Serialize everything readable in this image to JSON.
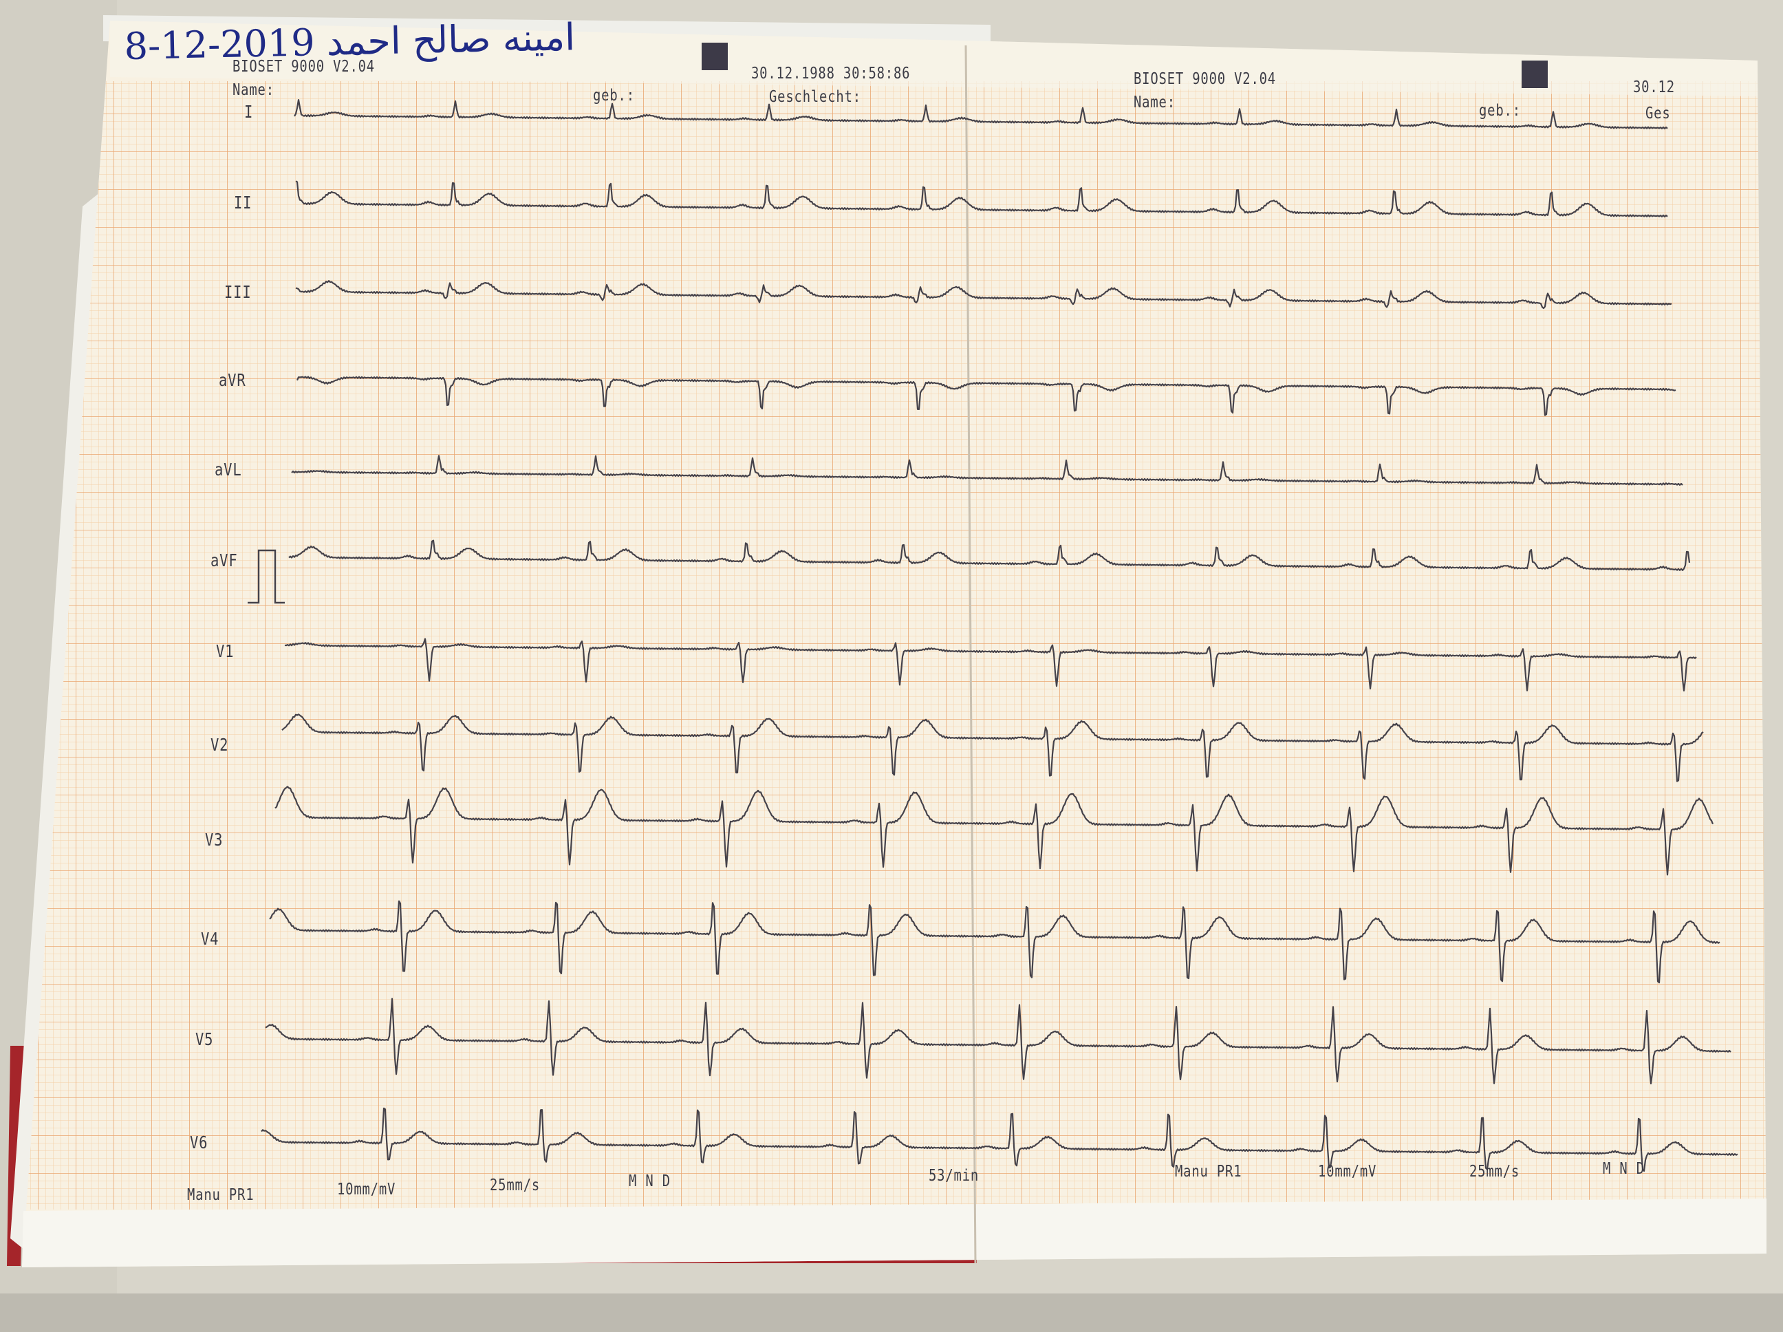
{
  "handwritten_note": "8-12-2019 امينه صالح احمد",
  "sheet_left": {
    "device": "BIOSET 9000 V2.04",
    "timestamp": "30.12.1988 30:58:86",
    "name_label": "Name:",
    "birth_label": "geb.:",
    "sex_label": "Geschlecht:",
    "footer": {
      "mode": "Manu PR1",
      "gain": "10mm/mV",
      "speed": "25mm/s",
      "filters": "M N D",
      "heart_rate": "53/min"
    }
  },
  "sheet_right": {
    "device": "BIOSET 9000 V2.04",
    "timestamp_partial": "30.12",
    "name_label": "Name:",
    "birth_label": "geb.:",
    "sex_label_partial": "Ges",
    "footer": {
      "mode": "Manu PR1",
      "gain": "10mm/mV",
      "speed": "25mm/s",
      "filters": "M N D"
    }
  },
  "leads": [
    "I",
    "II",
    "III",
    "aVR",
    "aVL",
    "aVF",
    "V1",
    "V2",
    "V3",
    "V4",
    "V5",
    "V6"
  ],
  "colors": {
    "grid_fine": "#f4c89a",
    "grid_major": "#eba56c",
    "paper": "#f7f0e1",
    "trace": "#45424a",
    "ink": "#1f2a86"
  }
}
